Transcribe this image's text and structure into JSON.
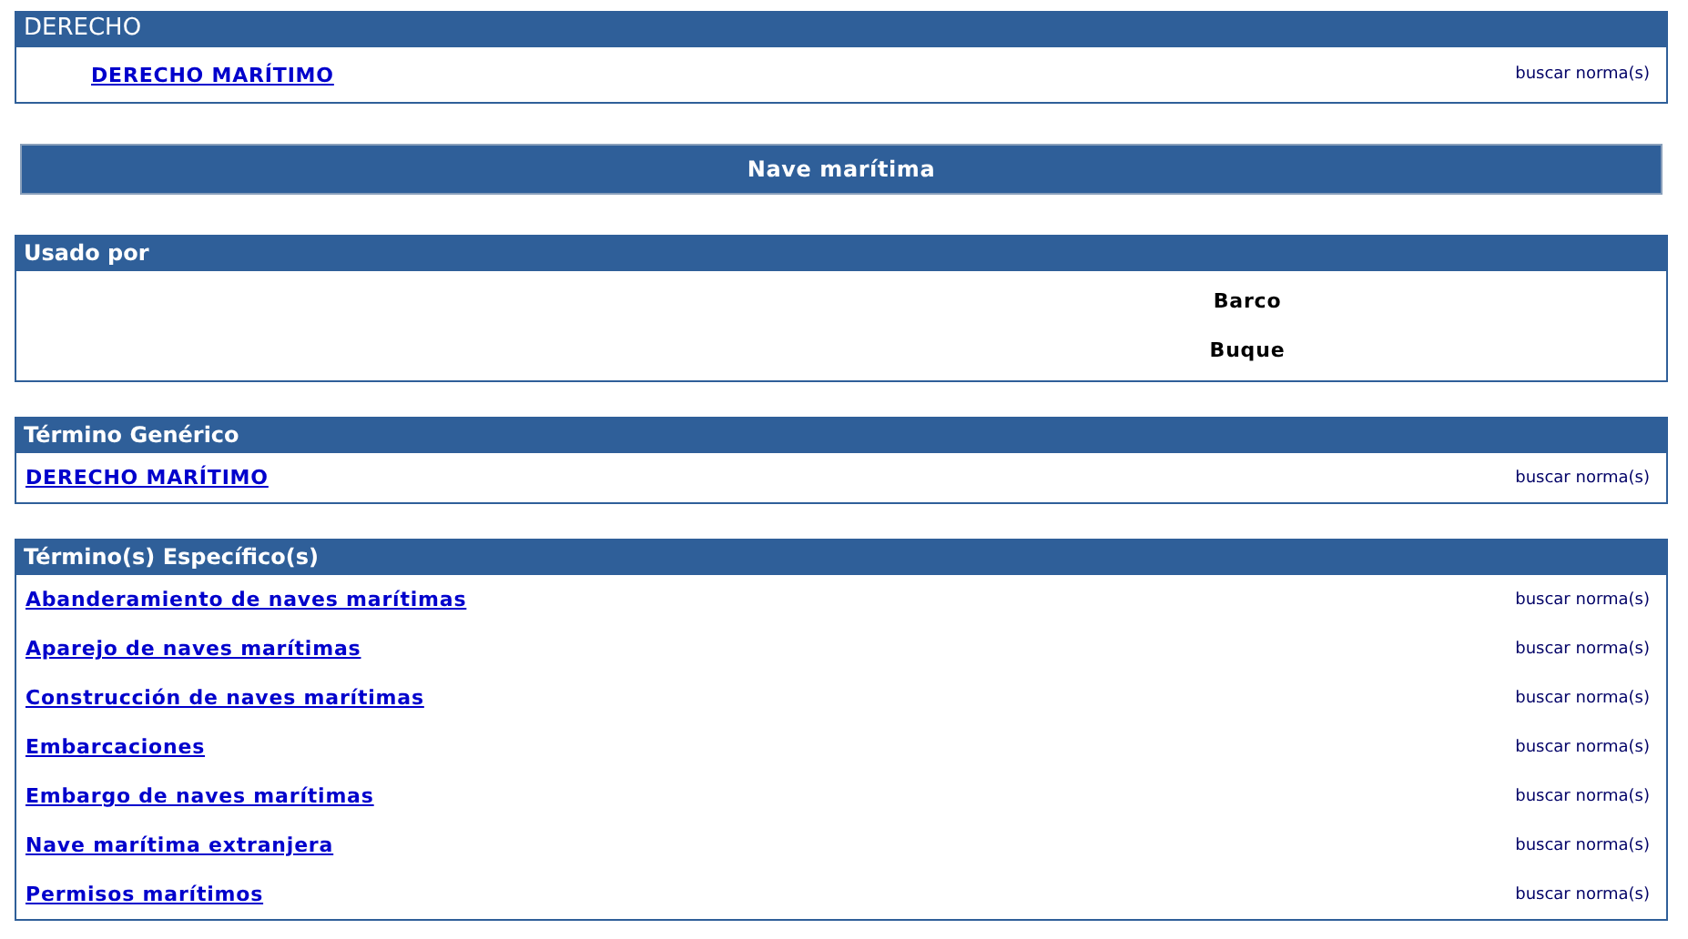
{
  "sections": [
    {
      "title": "DERECHO",
      "kind": "indented_links",
      "items": [
        {
          "label": "DERECHO MARÍTIMO",
          "action": "buscar norma(s)"
        }
      ]
    },
    {
      "title": "Nave marítima",
      "kind": "banner"
    },
    {
      "title": "Usado por",
      "kind": "centered_list",
      "items": [
        {
          "label": "Barco"
        },
        {
          "label": "Buque"
        }
      ]
    },
    {
      "title": "Término Genérico",
      "kind": "links",
      "items": [
        {
          "label": "DERECHO MARÍTIMO",
          "action": "buscar norma(s)"
        }
      ]
    },
    {
      "title": "Término(s) Específico(s)",
      "kind": "links",
      "items": [
        {
          "label": "Abanderamiento de naves marítimas",
          "action": "buscar norma(s)"
        },
        {
          "label": "Aparejo de naves marítimas",
          "action": "buscar norma(s)"
        },
        {
          "label": "Construcción de naves marítimas",
          "action": "buscar norma(s)"
        },
        {
          "label": "Embarcaciones",
          "action": "buscar norma(s)"
        },
        {
          "label": "Embargo de naves marítimas",
          "action": "buscar norma(s)"
        },
        {
          "label": "Nave marítima extranjera",
          "action": "buscar norma(s)"
        },
        {
          "label": "Permisos marítimos",
          "action": "buscar norma(s)"
        }
      ]
    }
  ]
}
